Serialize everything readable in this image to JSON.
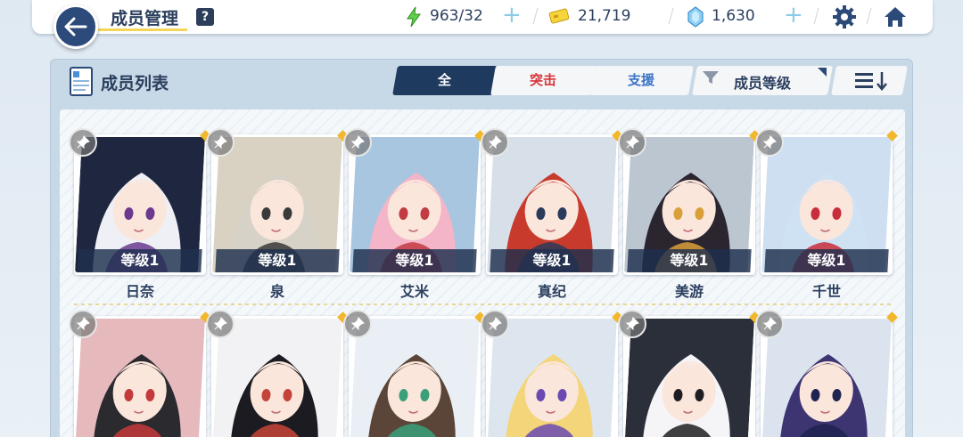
{
  "header": {
    "title": "成员管理",
    "help_label": "?",
    "resources": {
      "energy": "963/32",
      "credits": "21,719",
      "gems": "1,630"
    }
  },
  "panel": {
    "title": "成员列表",
    "tabs": [
      {
        "label": "全"
      },
      {
        "label": "突击"
      },
      {
        "label": "支援"
      }
    ],
    "sort_label": "成员等级"
  },
  "members": [
    {
      "name": "日奈",
      "level": "等级1",
      "hair": "#eef0f5",
      "accent": "#6b3a8f",
      "bg": "#1f2740"
    },
    {
      "name": "泉",
      "level": "等级1",
      "hair": "#d7d2c8",
      "accent": "#3a3a3a",
      "bg": "#d9d2c2"
    },
    {
      "name": "艾米",
      "level": "等级1",
      "hair": "#f3b5c7",
      "accent": "#c23a42",
      "bg": "#a8c6df"
    },
    {
      "name": "真纪",
      "level": "等级1",
      "hair": "#c73a2c",
      "accent": "#2a3a5a",
      "bg": "#d7dfe8"
    },
    {
      "name": "美游",
      "level": "等级1",
      "hair": "#2b2530",
      "accent": "#d9a03a",
      "bg": "#bcc6d1"
    },
    {
      "name": "千世",
      "level": "等级1",
      "hair": "#cfe2f4",
      "accent": "#c92c3a",
      "bg": "#cddff0"
    },
    {
      "name": "",
      "level": "",
      "hair": "#2a2a2f",
      "accent": "#c43a3a",
      "bg": "#e6b9bd"
    },
    {
      "name": "",
      "level": "",
      "hair": "#1c1b21",
      "accent": "#c5443a",
      "bg": "#f2f2f4"
    },
    {
      "name": "",
      "level": "",
      "hair": "#5a4538",
      "accent": "#3aa07a",
      "bg": "#e9eff4"
    },
    {
      "name": "",
      "level": "",
      "hair": "#f4d57a",
      "accent": "#6a4ab0",
      "bg": "#dde6ee"
    },
    {
      "name": "",
      "level": "",
      "hair": "#f5f5f7",
      "accent": "#1e1e22",
      "bg": "#2b2f3a"
    },
    {
      "name": "",
      "level": "",
      "hair": "#3d3472",
      "accent": "#1f2550",
      "bg": "#dbe4ee"
    }
  ]
}
